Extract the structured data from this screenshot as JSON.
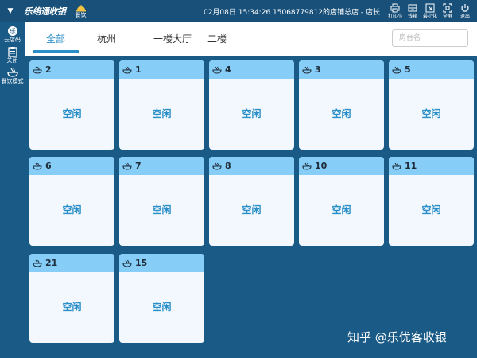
{
  "header": {
    "logo": "乐络通收银",
    "mode_label": "餐饮",
    "status": "02月08日 15:34:26  15068779812的店铺总店 - 店长",
    "tools": [
      {
        "label": "打印小",
        "icon": "printer-icon"
      },
      {
        "label": "钱箱",
        "icon": "cash-drawer-icon"
      },
      {
        "label": "最小化",
        "icon": "minimize-icon"
      },
      {
        "label": "全屏",
        "icon": "fullscreen-icon"
      },
      {
        "label": "退出",
        "icon": "power-icon"
      }
    ]
  },
  "rail": {
    "items": [
      {
        "label": "云店码",
        "icon": "cloud-store-icon"
      },
      {
        "label": "关闭",
        "icon": "clipboard-icon"
      },
      {
        "label": "餐饮模式",
        "icon": "dining-icon"
      }
    ]
  },
  "tabs": [
    {
      "label": "全部",
      "active": true
    },
    {
      "label": "杭州",
      "active": false
    },
    {
      "label": "一楼大厅",
      "active": false
    },
    {
      "label": "二楼",
      "active": false
    }
  ],
  "search": {
    "placeholder": "房台名"
  },
  "tables": [
    {
      "number": "2",
      "status": "空闲"
    },
    {
      "number": "1",
      "status": "空闲"
    },
    {
      "number": "4",
      "status": "空闲"
    },
    {
      "number": "3",
      "status": "空闲"
    },
    {
      "number": "5",
      "status": "空闲"
    },
    {
      "number": "6",
      "status": "空闲"
    },
    {
      "number": "7",
      "status": "空闲"
    },
    {
      "number": "8",
      "status": "空闲"
    },
    {
      "number": "10",
      "status": "空闲"
    },
    {
      "number": "11",
      "status": "空闲"
    },
    {
      "number": "21",
      "status": "空闲"
    },
    {
      "number": "15",
      "status": "空闲"
    }
  ],
  "watermark": "知乎 @乐优客收银",
  "colors": {
    "background": "#1a5a86",
    "card_header": "#86cdf7",
    "card_body": "#f2f8fd",
    "accent": "#2a8ec8"
  }
}
